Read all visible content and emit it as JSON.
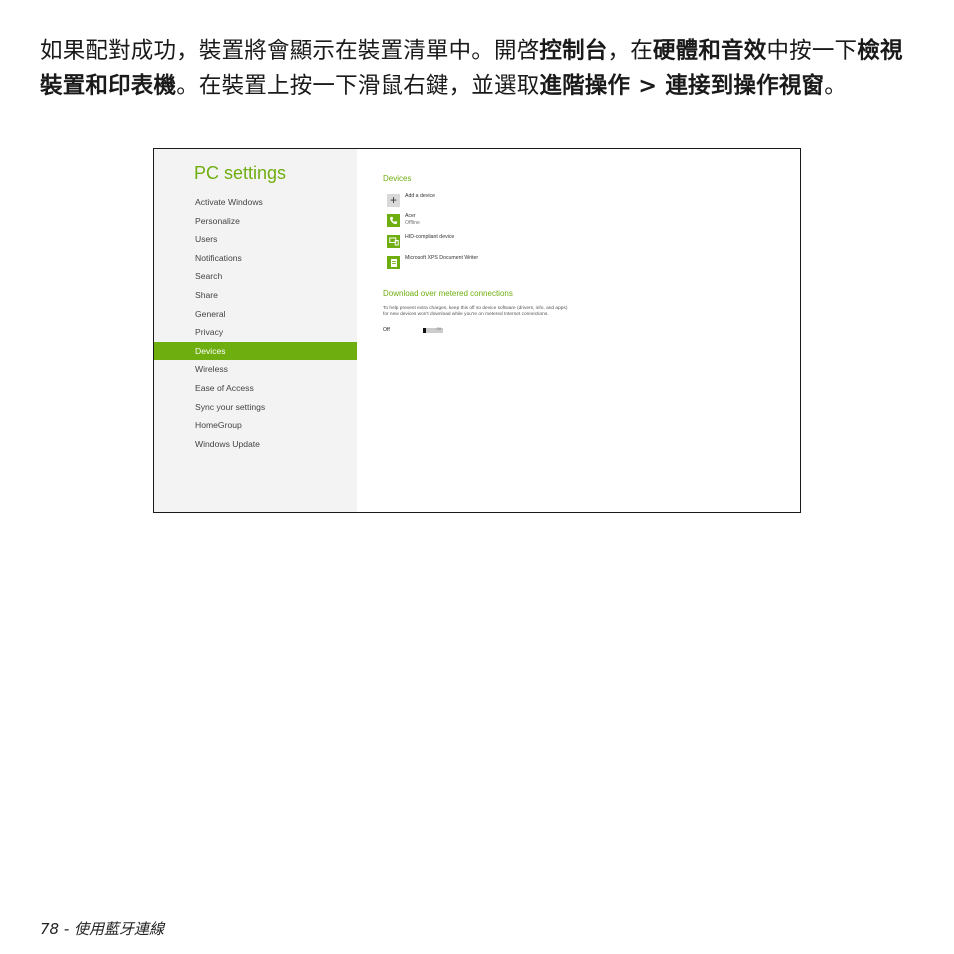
{
  "paragraph": {
    "t1": "如果配對成功，裝置將會顯示在裝置清單中。開啓",
    "b1": "控制台",
    "t2": "，在",
    "b2": "硬體和音效",
    "t3": "中按一下",
    "b3": "檢視裝置和印表機",
    "t4": "。在裝置上按一下滑鼠右鍵，並選取",
    "b4": "進階操作 > 連接到操作視窗",
    "t5": "。"
  },
  "screenshot": {
    "sidebar": {
      "title": "PC settings",
      "items": [
        {
          "label": "Activate Windows"
        },
        {
          "label": "Personalize"
        },
        {
          "label": "Users"
        },
        {
          "label": "Notifications"
        },
        {
          "label": "Search"
        },
        {
          "label": "Share"
        },
        {
          "label": "General"
        },
        {
          "label": "Privacy"
        },
        {
          "label": "Devices"
        },
        {
          "label": "Wireless"
        },
        {
          "label": "Ease of Access"
        },
        {
          "label": "Sync your settings"
        },
        {
          "label": "HomeGroup"
        },
        {
          "label": "Windows Update"
        }
      ],
      "active_item": "Devices"
    },
    "devices": {
      "title": "Devices",
      "add_label": "Add a device",
      "list": [
        {
          "name": "Acer",
          "status": "Offline",
          "icon": "phone-icon"
        },
        {
          "name": "HID-compliant device",
          "icon": "device-icon"
        },
        {
          "name": "Microsoft XPS Document Writer",
          "icon": "printer-icon"
        }
      ]
    },
    "metered": {
      "title": "Download over metered connections",
      "description": "To help prevent extra charges, keep this off so device software (drivers, info, and apps) for new devices won't download while you're on metered Internet connections.",
      "state_label": "Off",
      "toggle_text": "Off",
      "enabled": false
    },
    "accent_color": "#6fae0f"
  },
  "footer": {
    "page_number": "78",
    "separator": " - ",
    "section": "使用藍牙連線"
  }
}
